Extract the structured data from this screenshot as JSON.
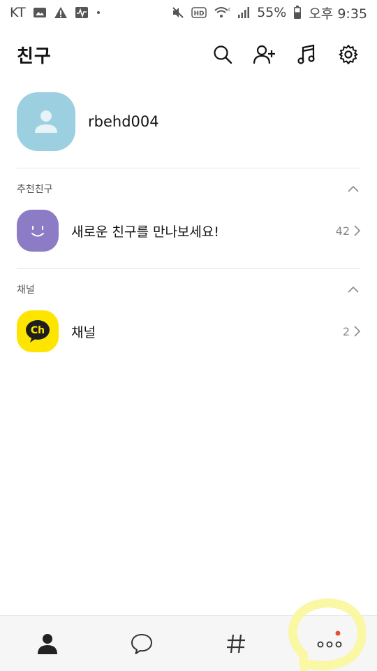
{
  "status_bar": {
    "carrier": "KT",
    "battery": "55%",
    "time": "오후 9:35",
    "icons": [
      "image-icon",
      "warning-icon",
      "activity-icon",
      "dot-icon",
      "mute-icon",
      "hd-icon",
      "wifi-icon",
      "signal-icon",
      "battery-icon"
    ]
  },
  "header": {
    "title": "친구",
    "actions": [
      "search-icon",
      "add-friend-icon",
      "music-icon",
      "settings-icon"
    ]
  },
  "profile": {
    "name": "rbehd004",
    "avatar_color": "#9ccfe0"
  },
  "sections": {
    "recommended": {
      "title": "추천친구",
      "item_label": "새로운 친구를 만나보세요!",
      "count": "42",
      "avatar_color": "#8c7cc6"
    },
    "channel": {
      "title": "채널",
      "item_label": "채널",
      "count": "2",
      "badge_text": "Ch",
      "avatar_color": "#fee500"
    }
  },
  "bottom_nav": {
    "items": [
      "friends-icon",
      "chat-icon",
      "hashtag-icon",
      "more-icon"
    ],
    "active": "friends-icon",
    "notification_color": "#e74c3c",
    "highlight_color": "#faf7a0"
  }
}
